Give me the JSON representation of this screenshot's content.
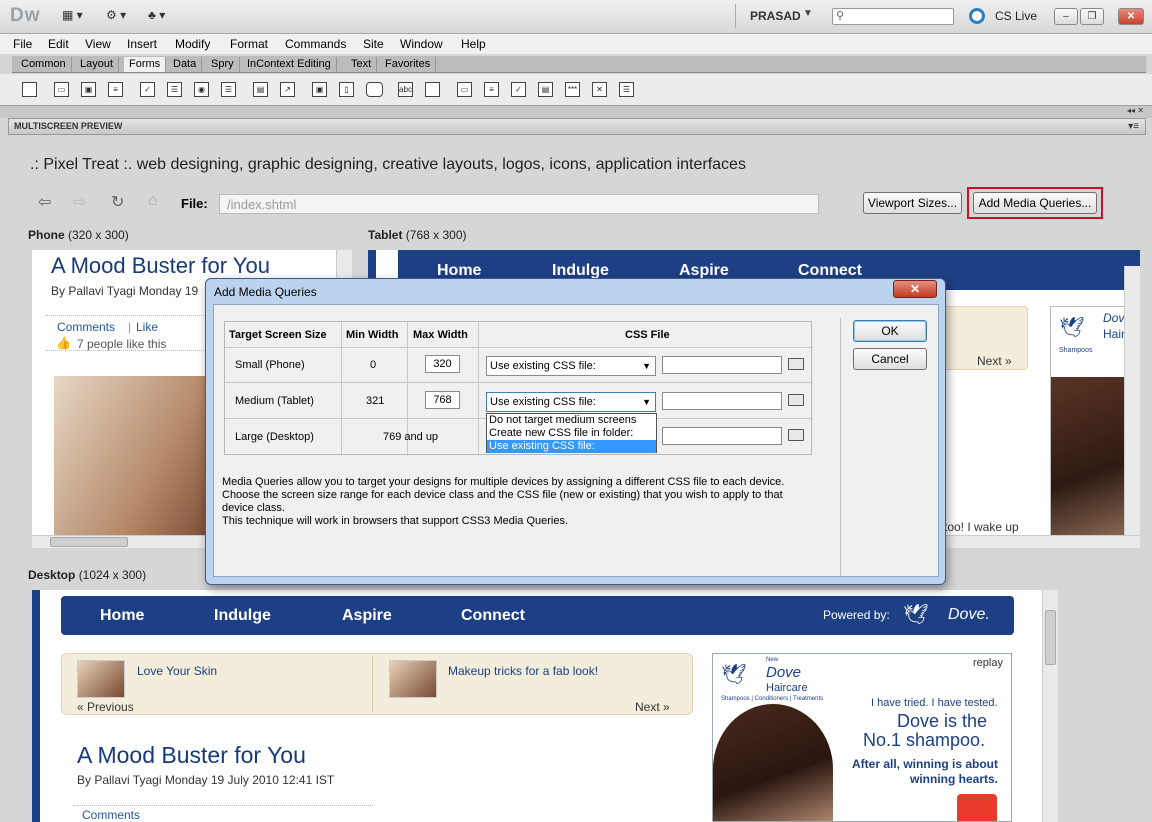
{
  "app": {
    "logo": "Dw",
    "user": "PRASAD",
    "cs_live": "CS Live",
    "window_buttons": [
      "–",
      "❐",
      "✕"
    ]
  },
  "menu": [
    "File",
    "Edit",
    "View",
    "Insert",
    "Modify",
    "Format",
    "Commands",
    "Site",
    "Window",
    "Help"
  ],
  "insert_tabs": [
    "Common",
    "Layout",
    "Forms",
    "Data",
    "Spry",
    "InContext Editing",
    "Text",
    "Favorites"
  ],
  "active_tab": "Forms",
  "panel": {
    "title": "MULTISCREEN PREVIEW"
  },
  "preview": {
    "page_heading": ".: Pixel Treat :. web designing, graphic designing, creative layouts, logos, icons, application interfaces",
    "file_label": "File:",
    "file_path": "/index.shtml",
    "viewport_button": "Viewport Sizes...",
    "media_button": "Add Media Queries...",
    "phone_label": "Phone",
    "phone_size": "(320 x 300)",
    "tablet_label": "Tablet",
    "tablet_size": "(768 x 300)",
    "desktop_label": "Desktop",
    "desktop_size": "(1024 x 300)"
  },
  "site": {
    "post_title": "A Mood Buster for You",
    "byline_short": "By Pallavi Tyagi   Monday 19",
    "byline_full": "By Pallavi Tyagi   Monday 19 July 2010 12:41 IST",
    "comments": "Comments",
    "like": "Like",
    "likes_text": "7 people like this",
    "comments_partial": "Comments",
    "nav": [
      "Home",
      "Indulge",
      "Aspire",
      "Connect"
    ],
    "powered_by": "Powered by:",
    "brand": "Dove.",
    "promo1": "Love Your Skin",
    "promo2": "Makeup tricks for a fab look!",
    "previous": "« Previous",
    "next": "Next »",
    "tablet_snippet": "too! I wake up",
    "ad": {
      "replay": "replay",
      "new": "New",
      "brand": "Dove",
      "product": "Haircare",
      "lines": "Shampoos | Conditioners | Treatments",
      "lines_short": "Shampoos",
      "tested": "I have tried. I have tested.",
      "claim1": "Dove is the",
      "claim2": "No.1 shampoo.",
      "after1": "After all, winning is about",
      "after2": "winning hearts.",
      "tablet_brand": "Dove",
      "tablet_product": "Hair"
    }
  },
  "dialog": {
    "title": "Add Media Queries",
    "close": "✕",
    "headers": [
      "Target Screen Size",
      "Min Width",
      "Max Width",
      "CSS File"
    ],
    "rows": [
      {
        "name": "Small (Phone)",
        "min": "0",
        "max": "320",
        "css": "Use existing CSS file:"
      },
      {
        "name": "Medium (Tablet)",
        "min": "321",
        "max": "768",
        "css": "Use existing CSS file:"
      },
      {
        "name": "Large (Desktop)",
        "range": "769 and up"
      }
    ],
    "dropdown_options": [
      "Do not target medium screens",
      "Create new CSS file in folder:",
      "Use existing CSS file:"
    ],
    "selected_option_index": 2,
    "help1": "Media Queries allow you to target your designs for multiple devices by assigning a different CSS file to each device. Choose the screen size range for each device class and the CSS file (new or existing) that you wish to apply to that device class.",
    "help2": "This technique will work in browsers that support CSS3 Media Queries.",
    "ok": "OK",
    "cancel": "Cancel"
  },
  "colors": {
    "accent_red": "#c8102e",
    "nav_blue": "#1d3f84",
    "selection": "#3399ff"
  }
}
